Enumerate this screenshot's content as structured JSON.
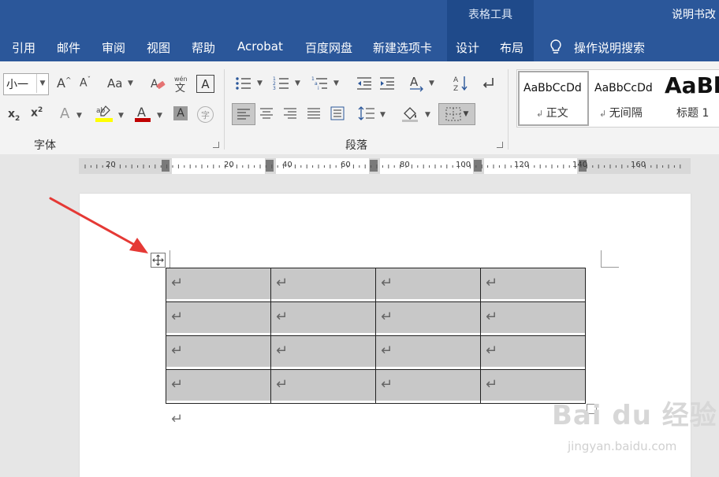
{
  "title_bar": {
    "context_group_label": "表格工具",
    "document_title": "说明书改"
  },
  "tabs": [
    {
      "label": "引用"
    },
    {
      "label": "邮件"
    },
    {
      "label": "审阅"
    },
    {
      "label": "视图"
    },
    {
      "label": "帮助"
    },
    {
      "label": "Acrobat"
    },
    {
      "label": "百度网盘"
    },
    {
      "label": "新建选项卡"
    },
    {
      "label": "设计"
    },
    {
      "label": "布局"
    }
  ],
  "tell_me": {
    "label": "操作说明搜索",
    "icon": "lightbulb-icon"
  },
  "ribbon": {
    "font_group": {
      "label": "字体",
      "font_size": "小一",
      "icons": [
        "grow-font-icon",
        "shrink-font-icon",
        "change-case-icon",
        "clear-formatting-icon",
        "phonetic-guide-icon",
        "character-border-icon",
        "subscript-icon",
        "superscript-icon",
        "text-effects-icon",
        "highlight-icon",
        "font-color-icon",
        "character-shading-icon",
        "enclose-characters-icon"
      ],
      "highlight_color": "#ffff00",
      "font_color": "#c00000"
    },
    "paragraph_group": {
      "label": "段落",
      "icons": [
        "bullets-icon",
        "numbering-icon",
        "multilevel-list-icon",
        "decrease-indent-icon",
        "increase-indent-icon",
        "asian-layout-icon",
        "sort-icon",
        "show-marks-icon",
        "align-left-icon",
        "center-icon",
        "align-right-icon",
        "justify-icon",
        "distributed-icon",
        "line-spacing-icon",
        "shading-icon",
        "borders-icon"
      ]
    },
    "styles": [
      {
        "sample": "AaBbCcDd",
        "name": "正文"
      },
      {
        "sample": "AaBbCcDd",
        "name": "无间隔"
      },
      {
        "sample": "AaBb",
        "name": "标题 1"
      }
    ]
  },
  "ruler": {
    "labels": [
      "20",
      "20",
      "40",
      "60",
      "80",
      "100",
      "120",
      "140",
      "160"
    ]
  },
  "table": {
    "rows": 4,
    "cols": 4,
    "cell_mark": "↵",
    "cell_shading": "#c8c8c8"
  },
  "paragraph_mark": "↵",
  "watermark": {
    "logo": "Bai du 经验",
    "url": "jingyan.baidu.com"
  },
  "colors": {
    "ribbon_blue": "#2b579a",
    "context_tab": "#1f4a8a",
    "arrow_red": "#e53935"
  }
}
